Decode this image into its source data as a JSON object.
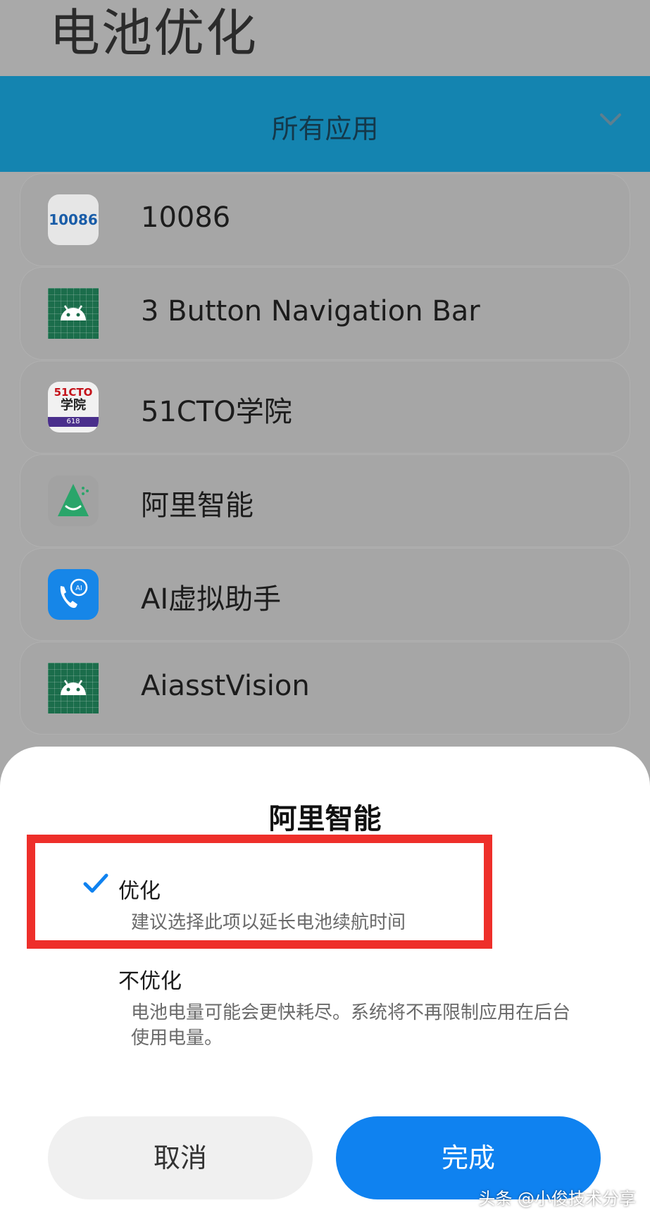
{
  "page": {
    "title": "电池优化"
  },
  "filter": {
    "label": "所有应用",
    "icon": "chevron-down-icon"
  },
  "apps": [
    {
      "name": "10086",
      "icon": "10086-icon",
      "icon_text": "10086"
    },
    {
      "name": "3 Button Navigation Bar",
      "icon": "android-icon"
    },
    {
      "name": "51CTO学院",
      "icon": "51cto-icon",
      "icon_text_1": "51CTO",
      "icon_text_2": "学院",
      "icon_text_3": "618"
    },
    {
      "name": "阿里智能",
      "icon": "ali-smart-icon"
    },
    {
      "name": "AI虚拟助手",
      "icon": "ai-assistant-icon"
    },
    {
      "name": "AiasstVision",
      "icon": "android-icon"
    }
  ],
  "dialog": {
    "title": "阿里智能",
    "options": [
      {
        "title": "优化",
        "desc": "建议选择此项以延长电池续航时间",
        "selected": true
      },
      {
        "title": "不优化",
        "desc": "电池电量可能会更快耗尽。系统将不再限制应用在后台使用电量。",
        "selected": false
      }
    ],
    "cancel_label": "取消",
    "done_label": "完成"
  },
  "watermark": "头条 @小俊技术分享",
  "colors": {
    "accent": "#0f82f0",
    "filter_bar": "#1484b0",
    "highlight": "#ee2f2a"
  }
}
